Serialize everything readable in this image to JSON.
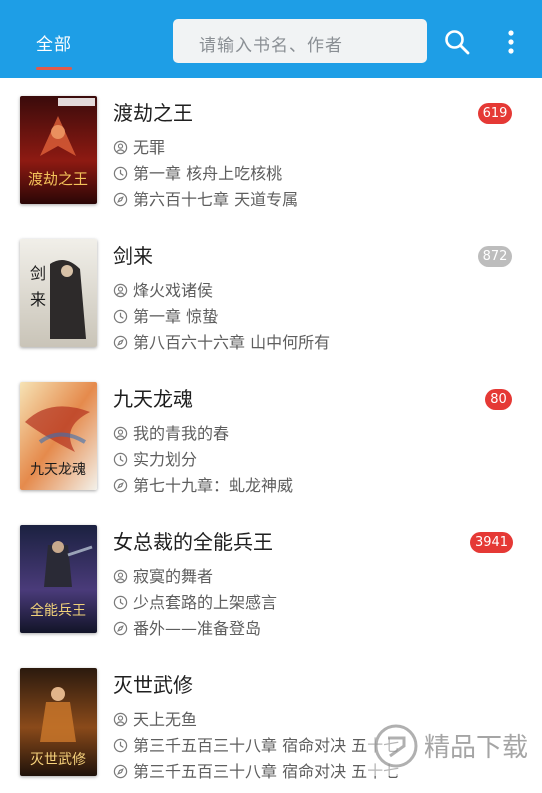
{
  "header": {
    "tab_label": "全部",
    "search_placeholder": "请输入书名、作者",
    "accent_color": "#1e9ee6",
    "icons": [
      "search-icon",
      "more-vertical-icon"
    ]
  },
  "books": [
    {
      "title": "渡劫之王",
      "author": "无罪",
      "first_chapter": "第一章 核舟上吃核桃",
      "latest_chapter": "第六百十七章 天道专属",
      "badge": "619",
      "badge_color": "#e53935",
      "cover_text": "渡劫之王"
    },
    {
      "title": "剑来",
      "author": "烽火戏诸侯",
      "first_chapter": "第一章 惊蛰",
      "latest_chapter": "第八百六十六章 山中何所有",
      "badge": "872",
      "badge_color": "#bdbdbd",
      "cover_text": "剑来"
    },
    {
      "title": "九天龙魂",
      "author": "我的青我的春",
      "first_chapter": "实力划分",
      "latest_chapter": "第七十九章：虬龙神威",
      "badge": "80",
      "badge_color": "#e53935",
      "cover_text": "九天龙魂"
    },
    {
      "title": "女总裁的全能兵王",
      "author": "寂寞的舞者",
      "first_chapter": "少点套路的上架感言",
      "latest_chapter": "番外——准备登岛",
      "badge": "3941",
      "badge_color": "#e53935",
      "cover_text": "全能兵王"
    },
    {
      "title": "灭世武修",
      "author": "天上无鱼",
      "first_chapter": "第三千五百三十八章 宿命对决 五十七",
      "latest_chapter": "第三千五百三十八章 宿命对决 五十七",
      "badge": "",
      "badge_color": "#e53935",
      "cover_text": "灭世武修"
    }
  ],
  "watermark_text": "精品下载"
}
